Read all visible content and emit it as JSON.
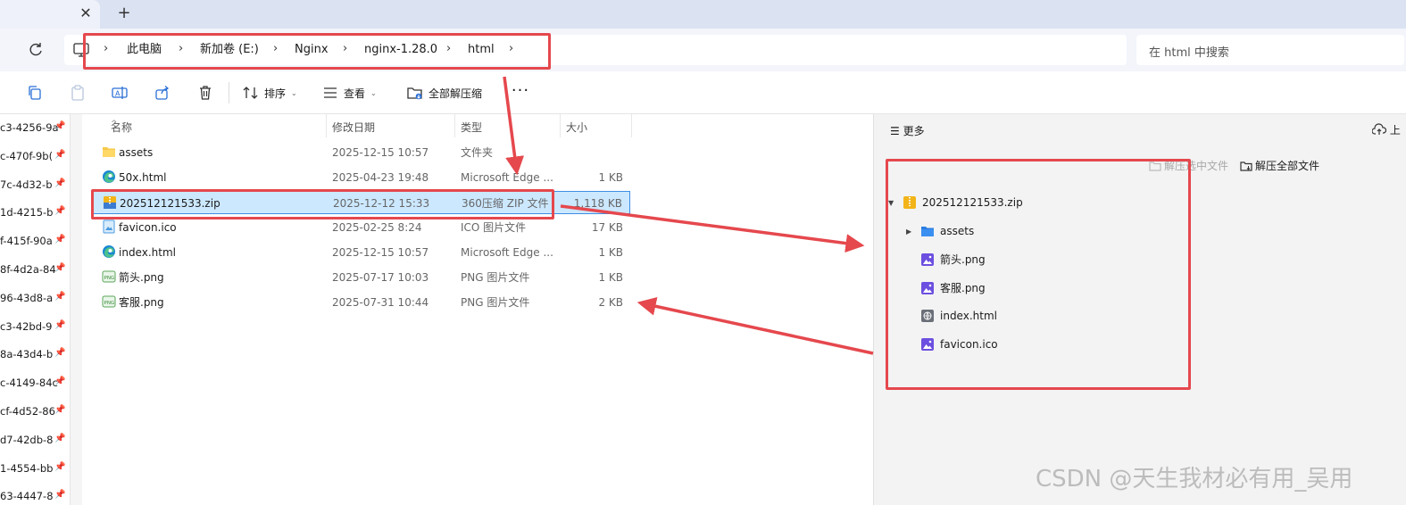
{
  "tabs": {
    "close_glyph": "✕",
    "new_tab_glyph": "+"
  },
  "breadcrumb": {
    "items": [
      "此电脑",
      "新加卷 (E:)",
      "Nginx",
      "nginx-1.28.0",
      "html"
    ],
    "separator": "›"
  },
  "search": {
    "placeholder": "在 html 中搜索"
  },
  "toolbar": {
    "sort_label": "排序",
    "view_label": "查看",
    "extract_all_label": "全部解压缩",
    "more_label": "···",
    "caret": "⌄"
  },
  "nav_items": [
    "c3-4256-9a",
    "c-470f-9b(",
    "7c-4d32-b",
    "1d-4215-b",
    "f-415f-90a",
    "8f-4d2a-84",
    "96-43d8-a",
    "c3-42bd-9",
    "8a-43d4-b",
    "c-4149-84c",
    "cf-4d52-86",
    "d7-42db-8",
    "1-4554-bb",
    "63-4447-8"
  ],
  "pin_glyph": "📌",
  "columns": {
    "name": "名称",
    "date": "修改日期",
    "type": "类型",
    "size": "大小",
    "sort_glyph": "^"
  },
  "files": [
    {
      "name": "assets",
      "date": "2025-12-15 10:57",
      "type": "文件夹",
      "size": "",
      "icon": "folder"
    },
    {
      "name": "50x.html",
      "date": "2025-04-23 19:48",
      "type": "Microsoft Edge ...",
      "size": "1 KB",
      "icon": "edge"
    },
    {
      "name": "202512121533.zip",
      "date": "2025-12-12 15:33",
      "type": "360压缩 ZIP 文件",
      "size": "1,118 KB",
      "icon": "zip",
      "selected": true
    },
    {
      "name": "favicon.ico",
      "date": "2025-02-25 8:24",
      "type": "ICO 图片文件",
      "size": "17 KB",
      "icon": "ico"
    },
    {
      "name": "index.html",
      "date": "2025-12-15 10:57",
      "type": "Microsoft Edge ...",
      "size": "1 KB",
      "icon": "edge"
    },
    {
      "name": "箭头.png",
      "date": "2025-07-17 10:03",
      "type": "PNG 图片文件",
      "size": "1 KB",
      "icon": "png"
    },
    {
      "name": "客服.png",
      "date": "2025-07-31 10:44",
      "type": "PNG 图片文件",
      "size": "2 KB",
      "icon": "png"
    }
  ],
  "pane": {
    "more_label": "更多",
    "upload_label": "上",
    "extract_selected_label": "解压选中文件",
    "extract_all_label": "解压全部文件",
    "tree": {
      "root": "202512121533.zip",
      "children": [
        {
          "name": "assets",
          "icon": "folder",
          "expandable": true
        },
        {
          "name": "箭头.png",
          "icon": "image"
        },
        {
          "name": "客服.png",
          "icon": "image"
        },
        {
          "name": "index.html",
          "icon": "html"
        },
        {
          "name": "favicon.ico",
          "icon": "image"
        }
      ]
    }
  },
  "watermark": "CSDN @天生我材必有用_吴用",
  "colors": {
    "annotation_red": "#e5484d",
    "selection": "#cce8ff",
    "selection_border": "#3d8ee4",
    "tabbar": "#dbe2f2"
  }
}
